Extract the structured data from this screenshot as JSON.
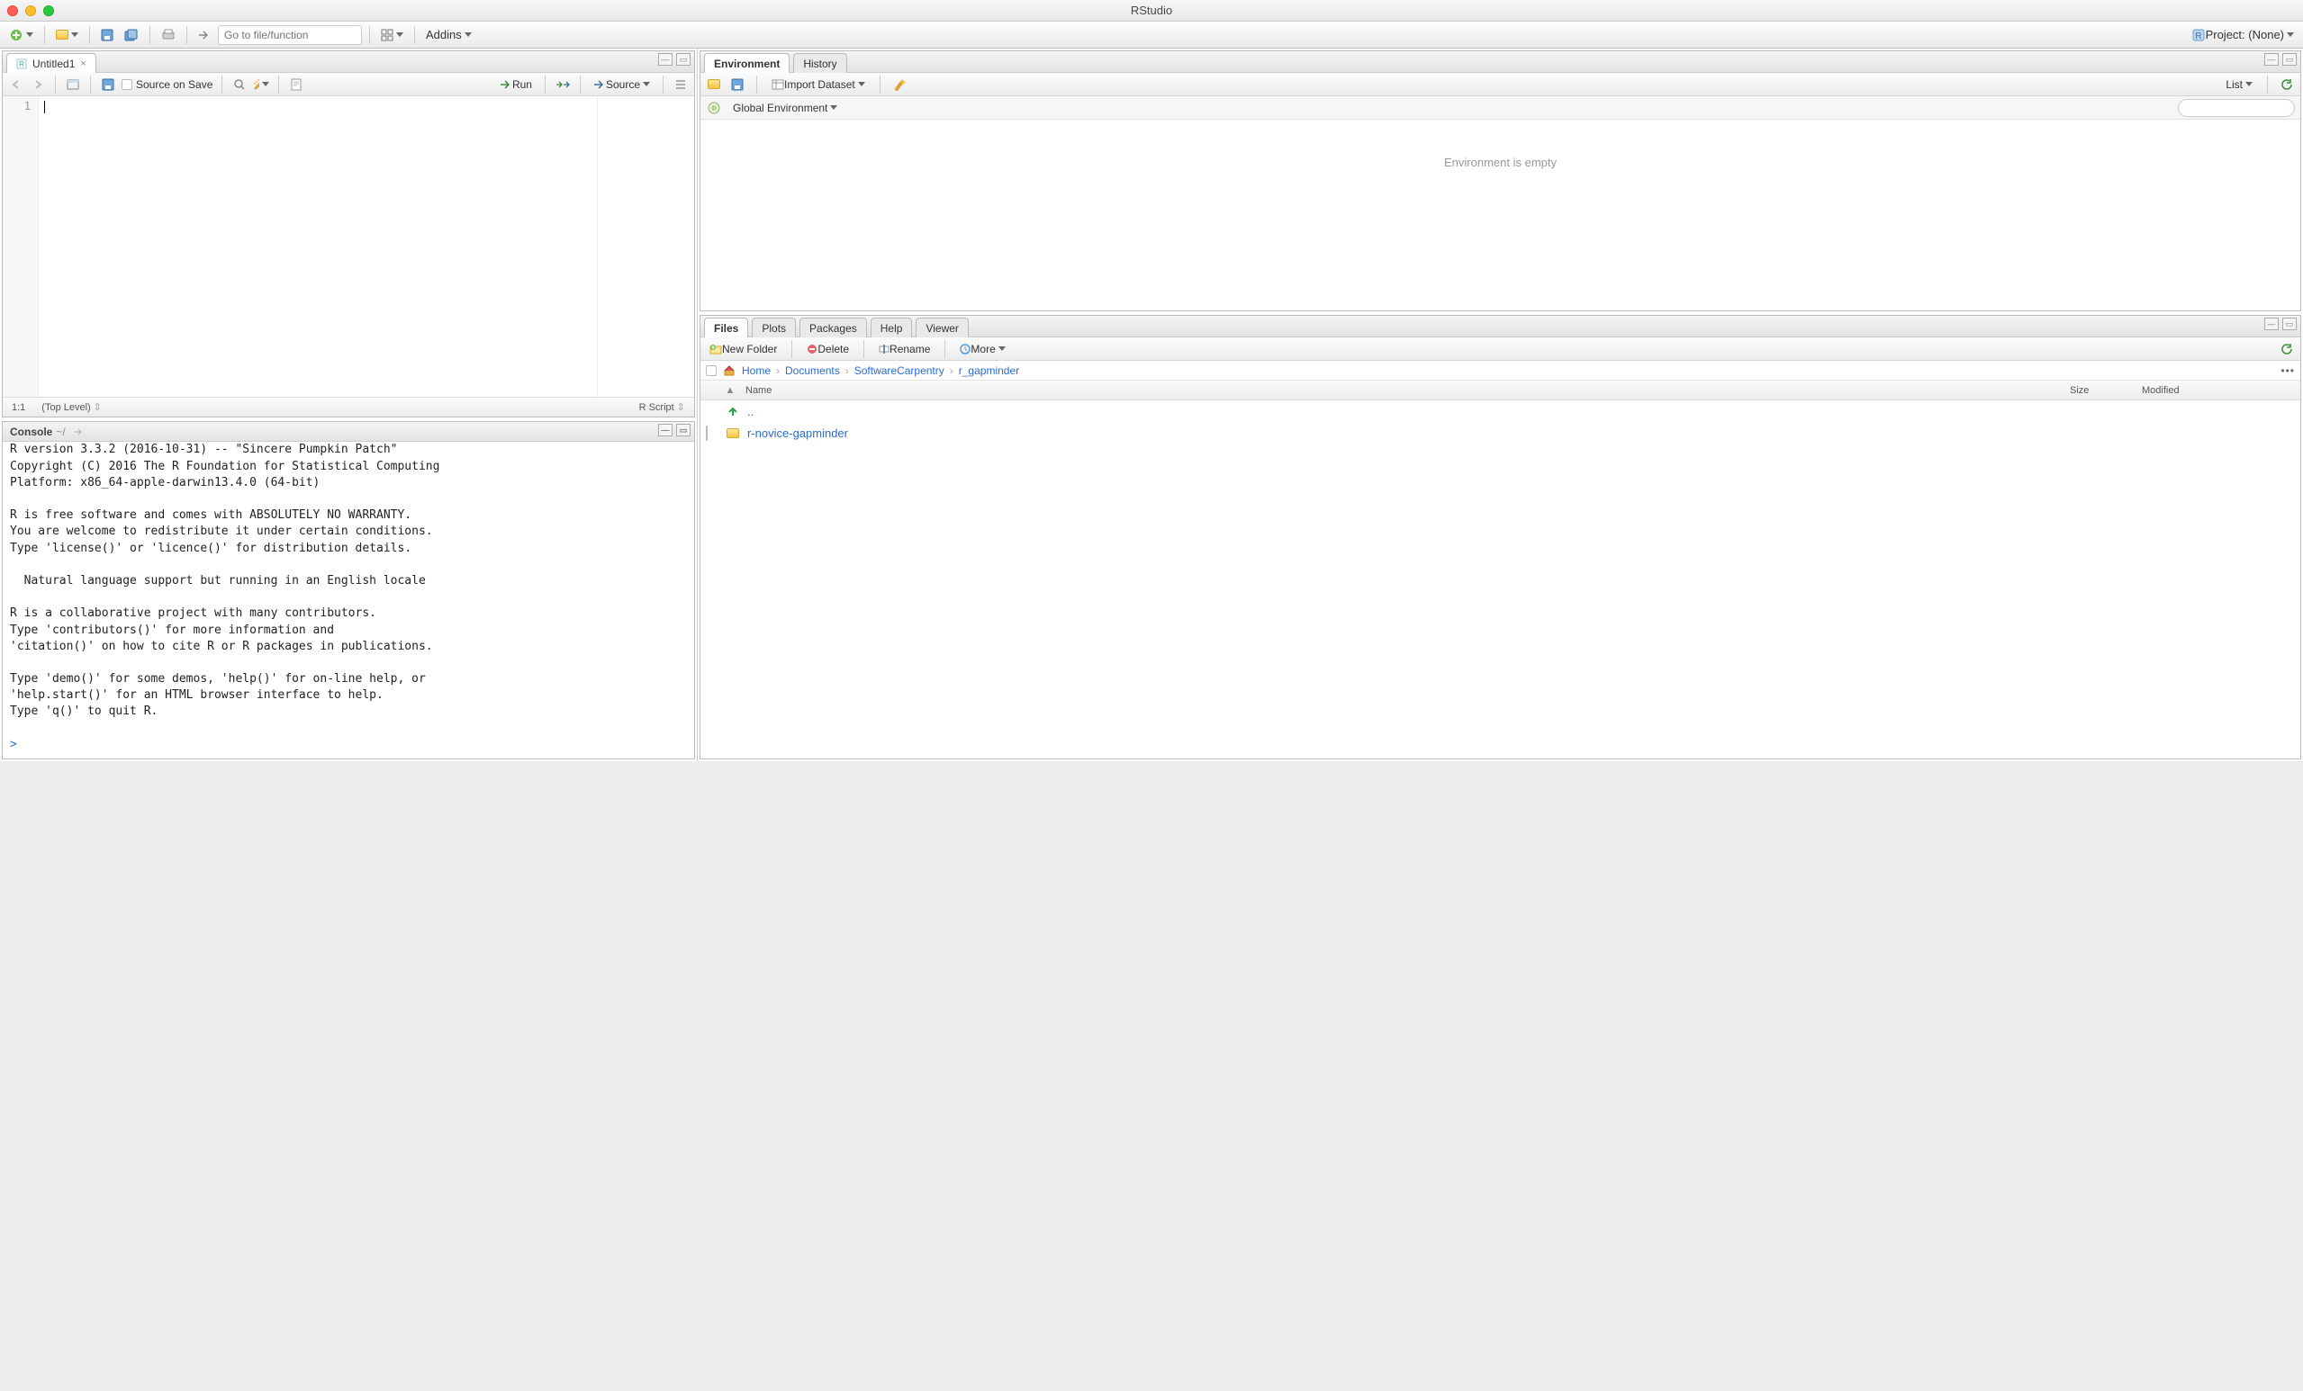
{
  "window": {
    "title": "RStudio"
  },
  "main_toolbar": {
    "goto_placeholder": "Go to file/function",
    "addins_label": "Addins",
    "project_label": "Project: (None)"
  },
  "source": {
    "tab_title": "Untitled1",
    "toolbar": {
      "source_on_save": "Source on Save",
      "run": "Run",
      "source": "Source"
    },
    "gutter_line": "1",
    "status_pos": "1:1",
    "status_scope": "(Top Level)",
    "status_type": "R Script"
  },
  "console": {
    "title": "Console",
    "path": "~/",
    "text": "R version 3.3.2 (2016-10-31) -- \"Sincere Pumpkin Patch\"\nCopyright (C) 2016 The R Foundation for Statistical Computing\nPlatform: x86_64-apple-darwin13.4.0 (64-bit)\n\nR is free software and comes with ABSOLUTELY NO WARRANTY.\nYou are welcome to redistribute it under certain conditions.\nType 'license()' or 'licence()' for distribution details.\n\n  Natural language support but running in an English locale\n\nR is a collaborative project with many contributors.\nType 'contributors()' for more information and\n'citation()' on how to cite R or R packages in publications.\n\nType 'demo()' for some demos, 'help()' for on-line help, or\n'help.start()' for an HTML browser interface to help.\nType 'q()' to quit R.\n",
    "prompt": ">"
  },
  "env_pane": {
    "tabs": {
      "environment": "Environment",
      "history": "History"
    },
    "import_dataset": "Import Dataset",
    "list_mode": "List",
    "scope": "Global Environment",
    "empty_msg": "Environment is empty"
  },
  "files_pane": {
    "tabs": {
      "files": "Files",
      "plots": "Plots",
      "packages": "Packages",
      "help": "Help",
      "viewer": "Viewer"
    },
    "toolbar": {
      "new_folder": "New Folder",
      "delete": "Delete",
      "rename": "Rename",
      "more": "More"
    },
    "breadcrumbs": {
      "home": "Home",
      "p1": "Documents",
      "p2": "SoftwareCarpentry",
      "p3": "r_gapminder"
    },
    "headers": {
      "name": "Name",
      "size": "Size",
      "modified": "Modified"
    },
    "rows": {
      "up": "..",
      "r0": "r-novice-gapminder"
    }
  }
}
